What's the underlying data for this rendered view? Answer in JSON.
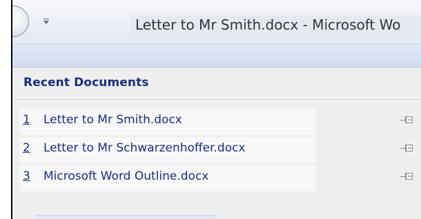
{
  "window": {
    "title": "Letter to Mr Smith.docx - Microsoft Wo"
  },
  "recent_documents": {
    "header": "Recent Documents",
    "items": [
      {
        "number": "1",
        "name": "Letter to Mr Smith.docx"
      },
      {
        "number": "2",
        "name": "Letter to Mr Schwarzenhoffer.docx"
      },
      {
        "number": "3",
        "name": "Microsoft Word Outline.docx"
      }
    ]
  },
  "colors": {
    "link_text": "#15317e",
    "ribbon": "#cfdcf0",
    "panel_bg": "#efefef"
  },
  "icons": {
    "office_button": "office-button-icon",
    "qat_customize": "chevron-down-icon",
    "pin": "pin-icon"
  }
}
